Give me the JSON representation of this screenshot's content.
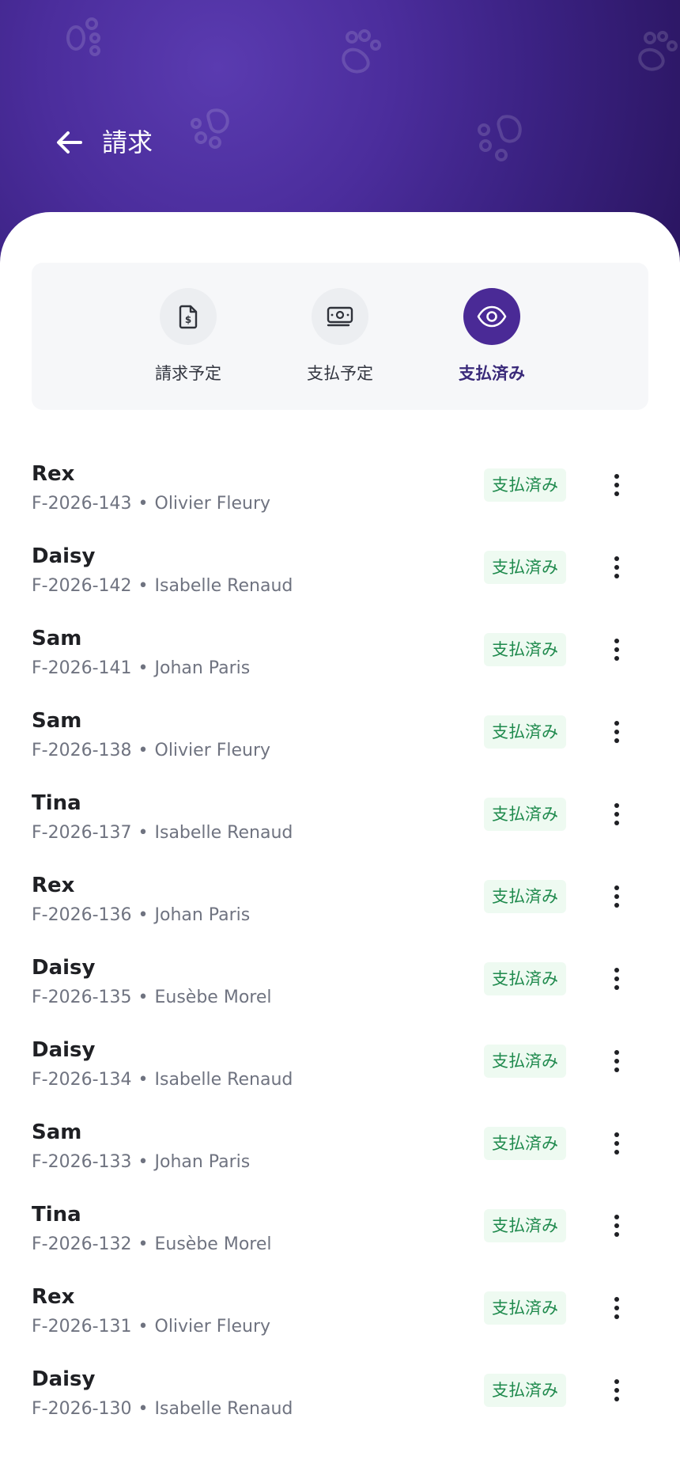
{
  "header": {
    "title": "請求"
  },
  "tabs": [
    {
      "label": "請求予定",
      "icon": "invoice-dollar-icon",
      "active": false
    },
    {
      "label": "支払予定",
      "icon": "banknotes-icon",
      "active": false
    },
    {
      "label": "支払済み",
      "icon": "eye-icon",
      "active": true
    }
  ],
  "invoices": [
    {
      "pet": "Rex",
      "number": "F-2026-143",
      "owner": "Olivier Fleury",
      "status": "支払済み"
    },
    {
      "pet": "Daisy",
      "number": "F-2026-142",
      "owner": "Isabelle Renaud",
      "status": "支払済み"
    },
    {
      "pet": "Sam",
      "number": "F-2026-141",
      "owner": "Johan Paris",
      "status": "支払済み"
    },
    {
      "pet": "Sam",
      "number": "F-2026-138",
      "owner": "Olivier Fleury",
      "status": "支払済み"
    },
    {
      "pet": "Tina",
      "number": "F-2026-137",
      "owner": "Isabelle Renaud",
      "status": "支払済み"
    },
    {
      "pet": "Rex",
      "number": "F-2026-136",
      "owner": "Johan Paris",
      "status": "支払済み"
    },
    {
      "pet": "Daisy",
      "number": "F-2026-135",
      "owner": "Eusèbe Morel",
      "status": "支払済み"
    },
    {
      "pet": "Daisy",
      "number": "F-2026-134",
      "owner": "Isabelle Renaud",
      "status": "支払済み"
    },
    {
      "pet": "Sam",
      "number": "F-2026-133",
      "owner": "Johan Paris",
      "status": "支払済み"
    },
    {
      "pet": "Tina",
      "number": "F-2026-132",
      "owner": "Eusèbe Morel",
      "status": "支払済み"
    },
    {
      "pet": "Rex",
      "number": "F-2026-131",
      "owner": "Olivier Fleury",
      "status": "支払済み"
    },
    {
      "pet": "Daisy",
      "number": "F-2026-130",
      "owner": "Isabelle Renaud",
      "status": "支払済み"
    }
  ],
  "separator": "•",
  "colors": {
    "header_primary": "#4b2d9c",
    "accent": "#4a2a96",
    "paid_text": "#1f8a4d",
    "paid_background": "#eefaf1"
  }
}
